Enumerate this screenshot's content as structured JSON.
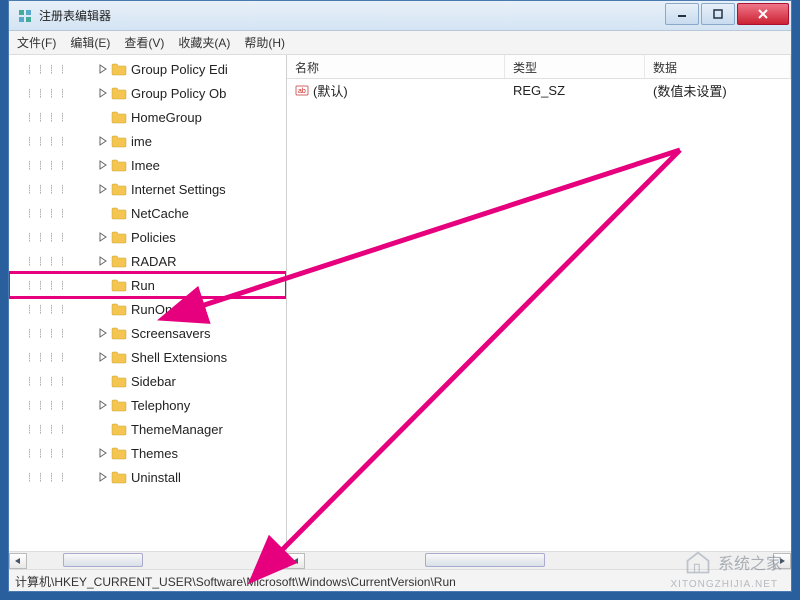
{
  "window": {
    "title": "注册表编辑器"
  },
  "menu": {
    "file": "文件(F)",
    "edit": "编辑(E)",
    "view": "查看(V)",
    "favorites": "收藏夹(A)",
    "help": "帮助(H)"
  },
  "tree": {
    "indent": 88,
    "items": [
      {
        "label": "Group Policy Edi",
        "expand": "collapsed"
      },
      {
        "label": "Group Policy Ob",
        "expand": "collapsed"
      },
      {
        "label": "HomeGroup",
        "expand": "none"
      },
      {
        "label": "ime",
        "expand": "collapsed"
      },
      {
        "label": "Imee",
        "expand": "collapsed"
      },
      {
        "label": "Internet Settings",
        "expand": "collapsed"
      },
      {
        "label": "NetCache",
        "expand": "none"
      },
      {
        "label": "Policies",
        "expand": "collapsed"
      },
      {
        "label": "RADAR",
        "expand": "collapsed"
      },
      {
        "label": "Run",
        "expand": "none",
        "highlight": true
      },
      {
        "label": "RunOnce",
        "expand": "none"
      },
      {
        "label": "Screensavers",
        "expand": "collapsed"
      },
      {
        "label": "Shell Extensions",
        "expand": "collapsed"
      },
      {
        "label": "Sidebar",
        "expand": "none"
      },
      {
        "label": "Telephony",
        "expand": "collapsed"
      },
      {
        "label": "ThemeManager",
        "expand": "none"
      },
      {
        "label": "Themes",
        "expand": "collapsed"
      },
      {
        "label": "Uninstall",
        "expand": "collapsed"
      }
    ]
  },
  "list": {
    "head": {
      "name": "名称",
      "type": "类型",
      "data": "数据"
    },
    "rows": [
      {
        "name": "(默认)",
        "type": "REG_SZ",
        "data": "(数值未设置)"
      }
    ]
  },
  "statusbar": "计算机\\HKEY_CURRENT_USER\\Software\\Microsoft\\Windows\\CurrentVersion\\Run",
  "watermark": {
    "main": "系统之家",
    "sub": "XITONGZHIJIA.NET"
  },
  "colors": {
    "highlight": "#e6007e",
    "folder": "#f5c551",
    "close": "#c8202d"
  }
}
